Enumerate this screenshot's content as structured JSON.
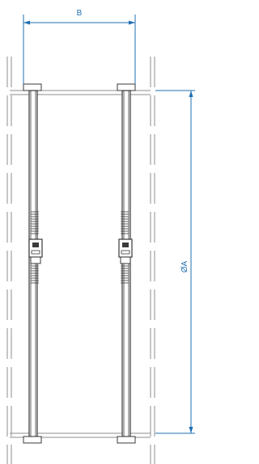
{
  "dimensions": {
    "width_label": "B",
    "diameter_label": "ØA"
  },
  "colors": {
    "outline": "#8c8c8c",
    "body": "#3a3a3a",
    "dimension": "#1f6fb2",
    "background": "#ffffff"
  }
}
